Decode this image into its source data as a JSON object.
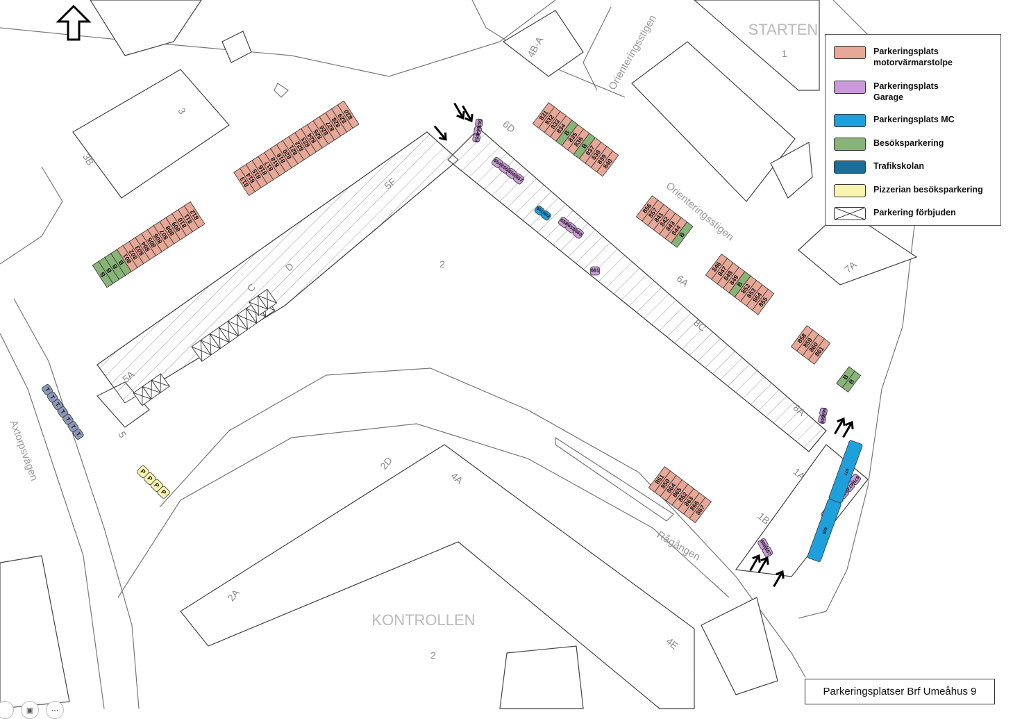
{
  "colors": {
    "motorvarmare": "#e8a898",
    "garage": "#c99ad8",
    "mc": "#1ea0dc",
    "besok": "#88b478",
    "trafikskolan": "#1a6e98",
    "pizzeria": "#f8f4b0",
    "trafik_slots": "#8c98b8",
    "line": "#666666",
    "building": "#ffffff"
  },
  "legend": [
    {
      "label": "Parkeringsplats\nmotorvärmarstolpe",
      "color": "#e8a898"
    },
    {
      "label": "Parkeringsplats\nGarage",
      "color": "#c99ad8"
    },
    {
      "label": "Parkeringsplats MC",
      "color": "#1ea0dc"
    },
    {
      "label": "Besöksparkering",
      "color": "#88b478"
    },
    {
      "label": "Trafikskolan",
      "color": "#1a6e98"
    },
    {
      "label": "Pizzerian besöksparkering",
      "color": "#f8f4b0"
    },
    {
      "label": "Parkering förbjuden",
      "color": "cross"
    }
  ],
  "title": "Parkeringsplatser Brf Umeåhus 9",
  "area_labels": {
    "starten": "STARTEN",
    "kontrollen": "KONTROLLEN"
  },
  "street_labels": {
    "orient1": "Orienteringsstigen",
    "orient2": "Orienteringsstigen",
    "axtorp": "Axtorpsvägen",
    "ragangen": "Rågången"
  },
  "house_labels": [
    "3",
    "3B",
    "1",
    "2",
    "2",
    "5F",
    "6D",
    "4B-A",
    "7A",
    "D",
    "C",
    "5A",
    "5",
    "6A",
    "8C",
    "8A",
    "1A",
    "1B",
    "2D",
    "4A",
    "2A",
    "4E"
  ],
  "parking": {
    "block_a": [
      "B",
      "B",
      "B",
      "B",
      "801",
      "802",
      "803",
      "804",
      "805",
      "806",
      "807",
      "808",
      "809",
      "810",
      "811",
      "812"
    ],
    "block_b": [
      "813",
      "814",
      "815",
      "816",
      "817",
      "818",
      "819",
      "820",
      "821",
      "822",
      "823",
      "824",
      "825",
      "826",
      "827",
      "828",
      "829",
      "830"
    ],
    "block_c": [
      "831",
      "832",
      "833",
      "834",
      "B",
      "835",
      "836",
      "B",
      "837",
      "838",
      "839",
      "840"
    ],
    "block_d": [
      "856",
      "857",
      "841",
      "842",
      "843",
      "844",
      "B"
    ],
    "block_e": [
      "846",
      "847",
      "848",
      "849",
      "B",
      "852",
      "853",
      "854",
      "855"
    ],
    "block_f": [
      "858",
      "859",
      "860",
      "861"
    ],
    "block_g": [
      "B",
      "B"
    ],
    "block_h": [
      "851",
      "850",
      "864",
      "865",
      "862",
      "863",
      "866",
      "867"
    ],
    "garage_a": [
      "663",
      "664",
      "653"
    ],
    "garage_b": [
      "654",
      "655",
      "656",
      "657"
    ],
    "garage_b_mc": [
      "601",
      "602"
    ],
    "garage_c": [
      "658",
      "659",
      "660"
    ],
    "garage_d": [
      "661"
    ],
    "garage_e": [
      "665",
      "666"
    ],
    "garage_f": [
      "675",
      "674",
      "673",
      "672",
      "671",
      "670"
    ],
    "garage_f_mc": [
      "677",
      "669"
    ],
    "garage_g": [
      "668",
      "667"
    ],
    "trafik": [
      "T",
      "T",
      "T",
      "T",
      "T",
      "T",
      "T"
    ],
    "pizzeria": [
      "P",
      "P",
      "P",
      "P"
    ]
  }
}
